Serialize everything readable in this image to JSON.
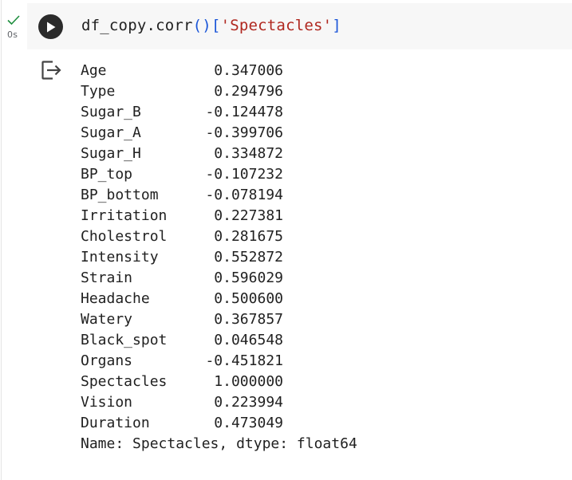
{
  "cell": {
    "exec_time": "0s",
    "code": {
      "part1": "df_copy.corr",
      "paren": "()",
      "bracket_open": "[",
      "string": "'Spectacles'",
      "bracket_close": "]"
    }
  },
  "output": {
    "rows": [
      {
        "name": "Age",
        "value": "0.347006"
      },
      {
        "name": "Type",
        "value": "0.294796"
      },
      {
        "name": "Sugar_B",
        "value": "-0.124478"
      },
      {
        "name": "Sugar_A",
        "value": "-0.399706"
      },
      {
        "name": "Sugar_H",
        "value": "0.334872"
      },
      {
        "name": "BP_top",
        "value": "-0.107232"
      },
      {
        "name": "BP_bottom",
        "value": "-0.078194"
      },
      {
        "name": "Irritation",
        "value": "0.227381"
      },
      {
        "name": "Cholestrol",
        "value": "0.281675"
      },
      {
        "name": "Intensity",
        "value": "0.552872"
      },
      {
        "name": "Strain",
        "value": "0.596029"
      },
      {
        "name": "Headache",
        "value": "0.500600"
      },
      {
        "name": "Watery",
        "value": "0.367857"
      },
      {
        "name": "Black_spot",
        "value": "0.046548"
      },
      {
        "name": "Organs",
        "value": "-0.451821"
      },
      {
        "name": "Spectacles",
        "value": "1.000000"
      },
      {
        "name": "Vision",
        "value": "0.223994"
      },
      {
        "name": "Duration",
        "value": "0.473049"
      }
    ],
    "footer": "Name: Spectacles, dtype: float64"
  },
  "icons": {
    "check": "check-icon",
    "run": "play-icon",
    "output": "output-redirect-icon"
  },
  "colors": {
    "check": "#1e8e3e",
    "run_button": "#2b2b2b",
    "code_string": "#b0271f",
    "code_paren": "#1a55d8"
  }
}
